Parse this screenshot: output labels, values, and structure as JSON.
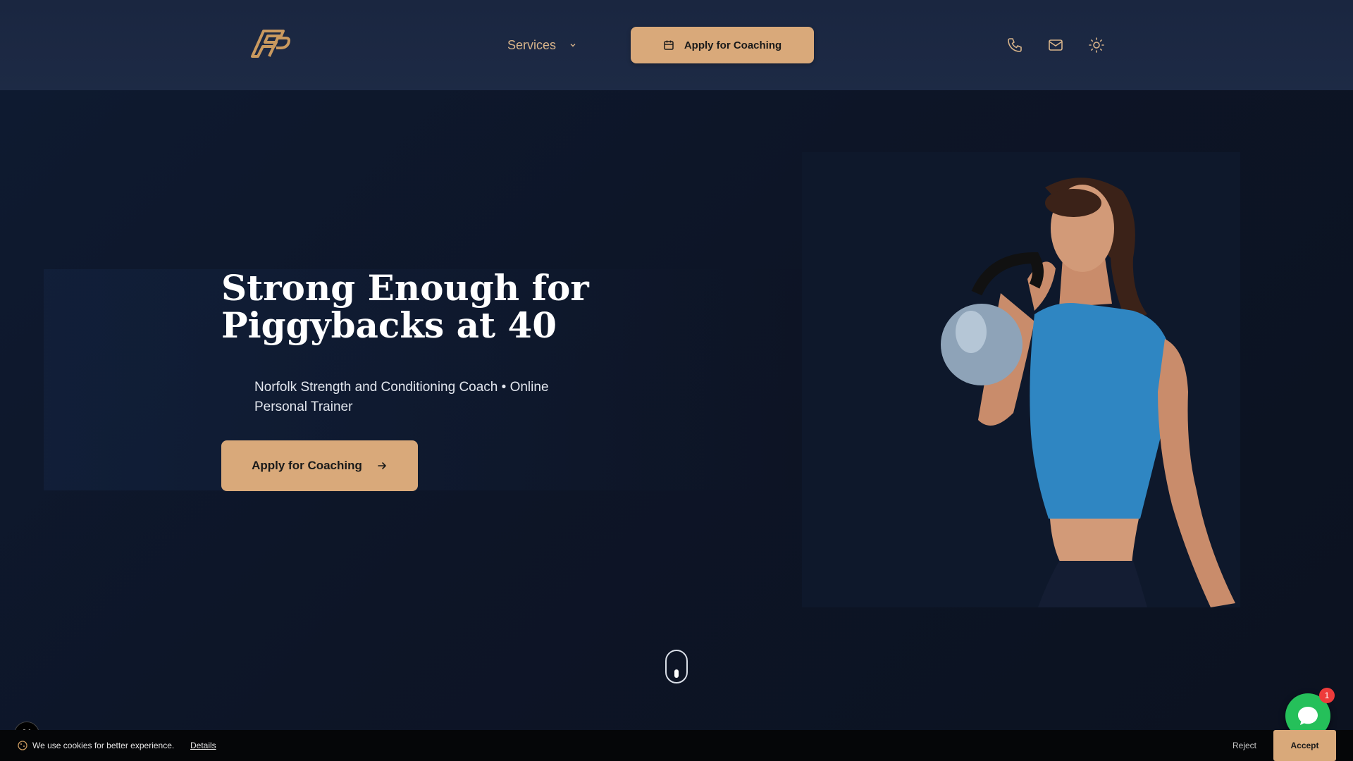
{
  "header": {
    "logo_icon": "fp-monogram-logo",
    "nav": {
      "services_label": "Services"
    },
    "cta_label": "Apply for Coaching",
    "icons": [
      "phone-icon",
      "mail-icon",
      "sun-icon"
    ]
  },
  "hero": {
    "title_line1": "Strong Enough for",
    "title_line2": "Piggybacks at 40",
    "subtitle": "Norfolk Strength and Conditioning Coach • Online Personal Trainer",
    "cta_label": "Apply for Coaching"
  },
  "cookie": {
    "text": "We use cookies for better experience.",
    "details_label": "Details",
    "reject_label": "Reject",
    "accept_label": "Accept"
  },
  "floating": {
    "n_badge": "N",
    "chat_count": "1"
  },
  "colors": {
    "accent": "#d9a97a",
    "header_bg": "#1a2640",
    "page_bg": "#0d1526",
    "chat_green": "#25c05a"
  }
}
